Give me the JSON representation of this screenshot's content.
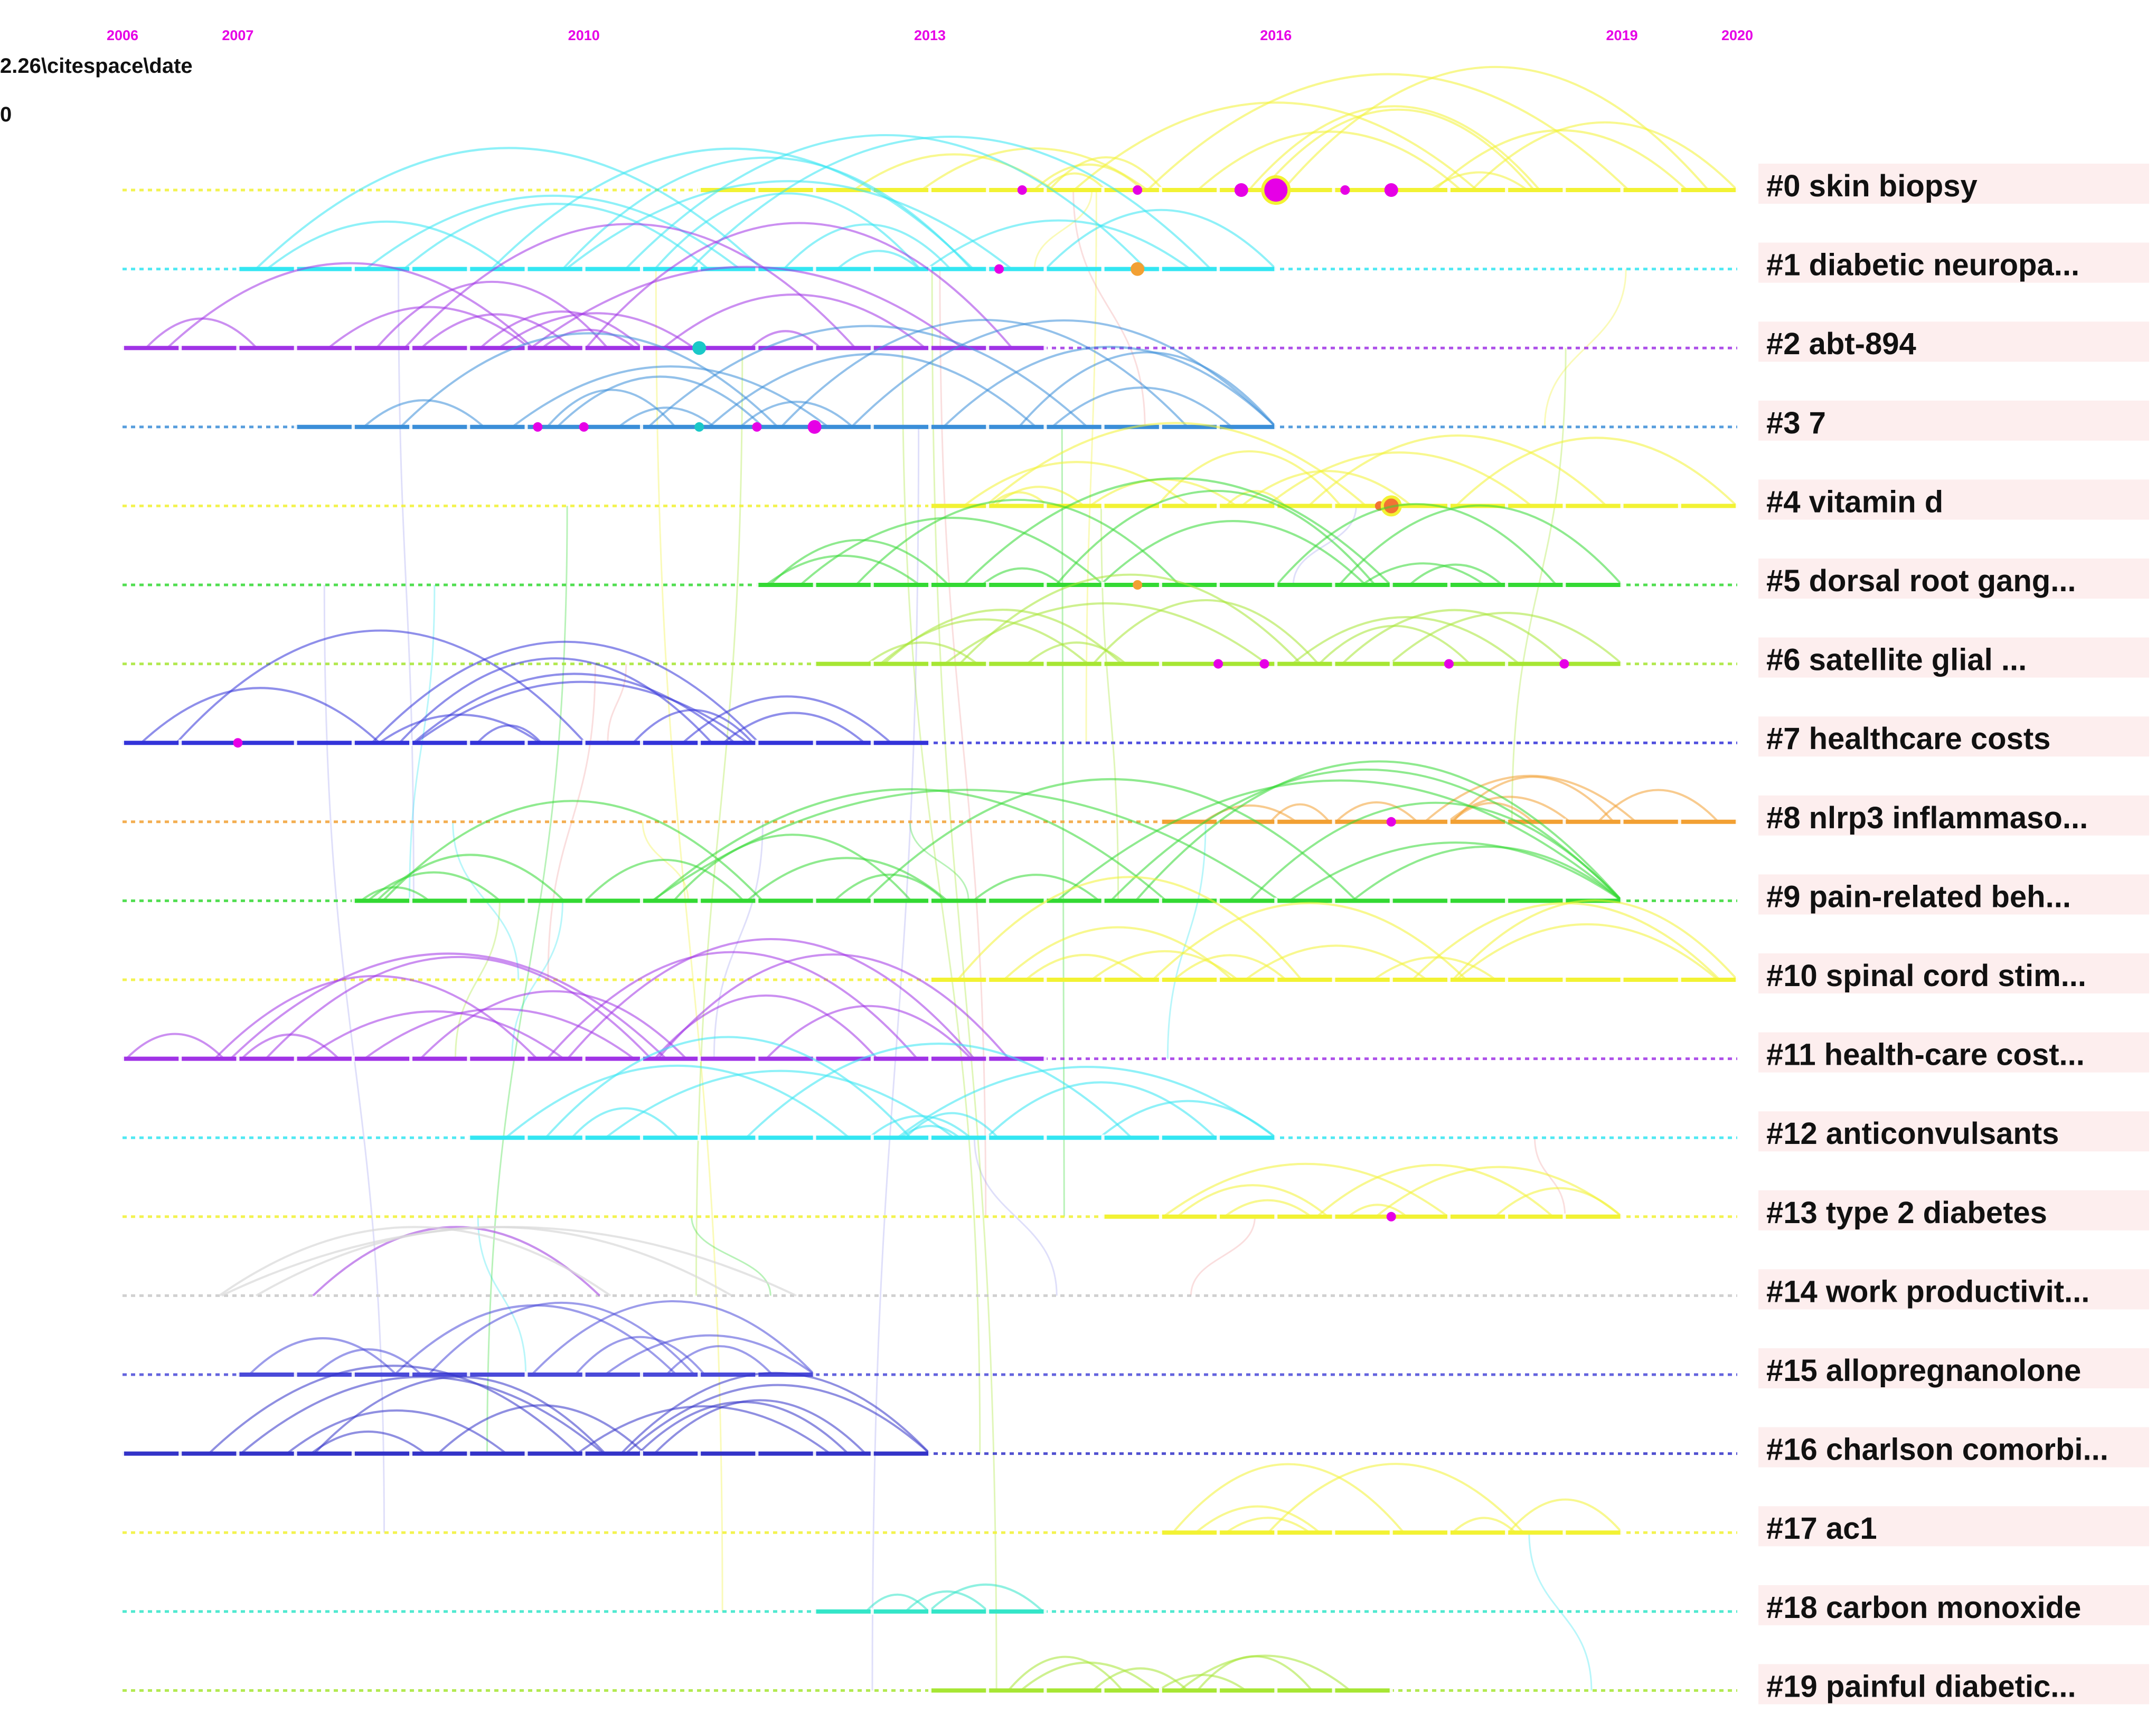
{
  "header": {
    "path_text": "2.26\\citespace\\date",
    "line2_text": "0"
  },
  "chart_data": {
    "type": "timeline",
    "x_axis": {
      "ticks": [
        2006,
        2007,
        2010,
        2013,
        2016,
        2019,
        2020
      ],
      "range": [
        2006,
        2020
      ],
      "tick_color": "#e600e6"
    },
    "clusters": [
      {
        "id": 0,
        "label": "#0 skin biopsy",
        "color": "#f2f233",
        "active": [
          2011,
          2020
        ],
        "nodes": [
          {
            "year": 2013.8,
            "size": 1,
            "color": "#e600e6"
          },
          {
            "year": 2014.8,
            "size": 1,
            "color": "#e600e6"
          },
          {
            "year": 2015.7,
            "size": 2,
            "color": "#e600e6"
          },
          {
            "year": 2016,
            "size": 5,
            "color": "#e600e6"
          },
          {
            "year": 2016.6,
            "size": 1,
            "color": "#e600e6"
          },
          {
            "year": 2017,
            "size": 2,
            "color": "#e600e6"
          }
        ]
      },
      {
        "id": 1,
        "label": "#1 diabetic neuropa...",
        "color": "#33e6f2",
        "active": [
          2007,
          2016
        ],
        "nodes": [
          {
            "year": 2013.6,
            "size": 1,
            "color": "#e600e6"
          },
          {
            "year": 2014.8,
            "size": 2,
            "color": "#f2a033"
          }
        ]
      },
      {
        "id": 2,
        "label": "#2 abt-894",
        "color": "#a033e6",
        "active": [
          2006,
          2014
        ],
        "nodes": [
          {
            "year": 2011,
            "size": 2,
            "color": "#1ac8c8"
          }
        ]
      },
      {
        "id": 3,
        "label": "#3 7",
        "color": "#3a8ed8",
        "active": [
          2007.5,
          2016
        ],
        "nodes": [
          {
            "year": 2009.6,
            "size": 1,
            "color": "#e600e6"
          },
          {
            "year": 2010,
            "size": 1,
            "color": "#e600e6"
          },
          {
            "year": 2011,
            "size": 1,
            "color": "#1ac8c8"
          },
          {
            "year": 2011.5,
            "size": 1,
            "color": "#e600e6"
          },
          {
            "year": 2012,
            "size": 2,
            "color": "#e600e6"
          }
        ]
      },
      {
        "id": 4,
        "label": "#4 vitamin d",
        "color": "#f2f233",
        "active": [
          2013,
          2020
        ],
        "nodes": [
          {
            "year": 2016.9,
            "size": 1,
            "color": "#f27333"
          },
          {
            "year": 2017,
            "size": 3,
            "color": "#f27333"
          }
        ]
      },
      {
        "id": 5,
        "label": "#5 dorsal root gang...",
        "color": "#33d933",
        "active": [
          2011.5,
          2019
        ],
        "nodes": [
          {
            "year": 2014.8,
            "size": 1,
            "color": "#f2a033"
          }
        ]
      },
      {
        "id": 6,
        "label": "#6 satellite glial ...",
        "color": "#a6e633",
        "active": [
          2012,
          2019
        ],
        "nodes": [
          {
            "year": 2015.5,
            "size": 1,
            "color": "#e600e6"
          },
          {
            "year": 2015.9,
            "size": 1,
            "color": "#e600e6"
          },
          {
            "year": 2017.5,
            "size": 1,
            "color": "#e600e6"
          },
          {
            "year": 2018.5,
            "size": 1,
            "color": "#e600e6"
          }
        ]
      },
      {
        "id": 7,
        "label": "#7 healthcare costs",
        "color": "#3333d9",
        "active": [
          2006,
          2013
        ],
        "nodes": [
          {
            "year": 2007,
            "size": 1,
            "color": "#e600e6"
          }
        ]
      },
      {
        "id": 8,
        "label": "#8 nlrp3 inflammaso...",
        "color": "#f2a033",
        "active": [
          2015,
          2020
        ],
        "nodes": [
          {
            "year": 2017,
            "size": 1,
            "color": "#e600e6"
          }
        ]
      },
      {
        "id": 9,
        "label": "#9 pain-related beh...",
        "color": "#33d933",
        "active": [
          2008,
          2019
        ],
        "nodes": []
      },
      {
        "id": 10,
        "label": "#10 spinal cord stim...",
        "color": "#f2f233",
        "active": [
          2013,
          2020
        ],
        "nodes": []
      },
      {
        "id": 11,
        "label": "#11 health-care cost...",
        "color": "#a033e6",
        "active": [
          2006,
          2014
        ],
        "nodes": []
      },
      {
        "id": 12,
        "label": "#12 anticonvulsants",
        "color": "#33e6f2",
        "active": [
          2009,
          2016
        ],
        "nodes": []
      },
      {
        "id": 13,
        "label": "#13 type 2 diabetes",
        "color": "#f2f233",
        "active": [
          2014.5,
          2019
        ],
        "nodes": [
          {
            "year": 2017,
            "size": 1,
            "color": "#e600e6"
          }
        ]
      },
      {
        "id": 14,
        "label": "#14 work productivit...",
        "color": "#c8c8c8",
        "active": null,
        "nodes": []
      },
      {
        "id": 15,
        "label": "#15 allopregnanolone",
        "color": "#4a4ad9",
        "active": [
          2007,
          2012
        ],
        "nodes": []
      },
      {
        "id": 16,
        "label": "#16 charlson comorbi...",
        "color": "#3333c8",
        "active": [
          2006,
          2013
        ],
        "nodes": []
      },
      {
        "id": 17,
        "label": "#17 ac1",
        "color": "#f2f233",
        "active": [
          2015,
          2019
        ],
        "nodes": []
      },
      {
        "id": 18,
        "label": "#18 carbon monoxide",
        "color": "#33e6c8",
        "active": [
          2012,
          2014
        ],
        "nodes": []
      },
      {
        "id": 19,
        "label": "#19 painful diabetic...",
        "color": "#a6e633",
        "active": [
          2013,
          2017
        ],
        "nodes": []
      }
    ]
  }
}
